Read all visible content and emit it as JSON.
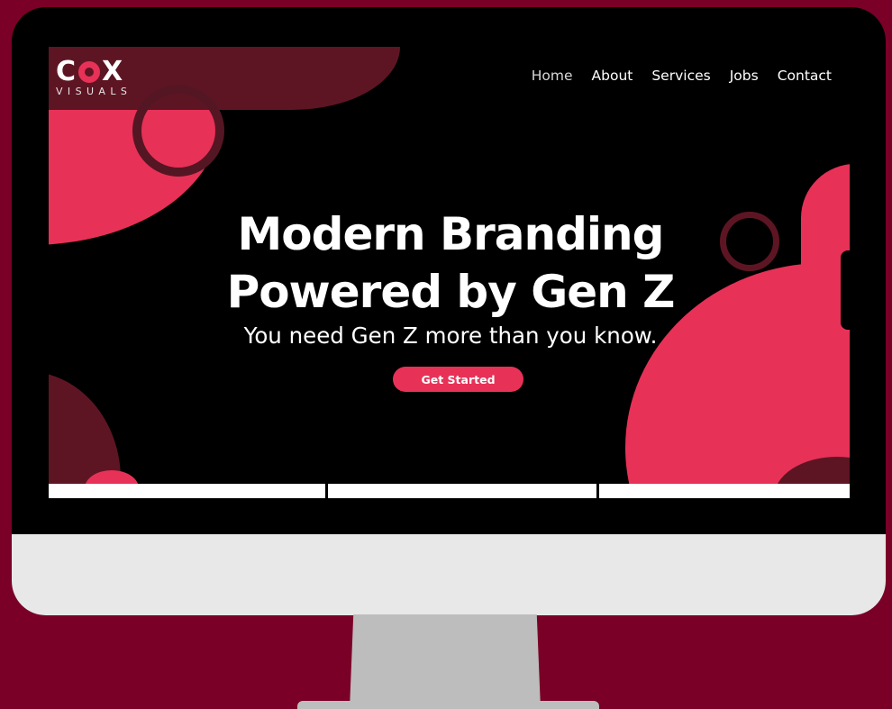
{
  "logo": {
    "main_left": "C",
    "main_right": "X",
    "sub": "VISUALS"
  },
  "nav": {
    "items": [
      "Home",
      "About",
      "Services",
      "Jobs",
      "Contact"
    ],
    "active": "Home"
  },
  "hero": {
    "title_line1": "Modern Branding",
    "title_line2": "Powered by Gen Z",
    "subtitle": "You need Gen Z more than you know.",
    "cta_label": "Get Started"
  },
  "colors": {
    "background": "#7a0028",
    "accent": "#e83157",
    "dark_accent": "#5e1523",
    "screen": "#000000"
  },
  "icons": [
    "logo-ring-icon"
  ]
}
